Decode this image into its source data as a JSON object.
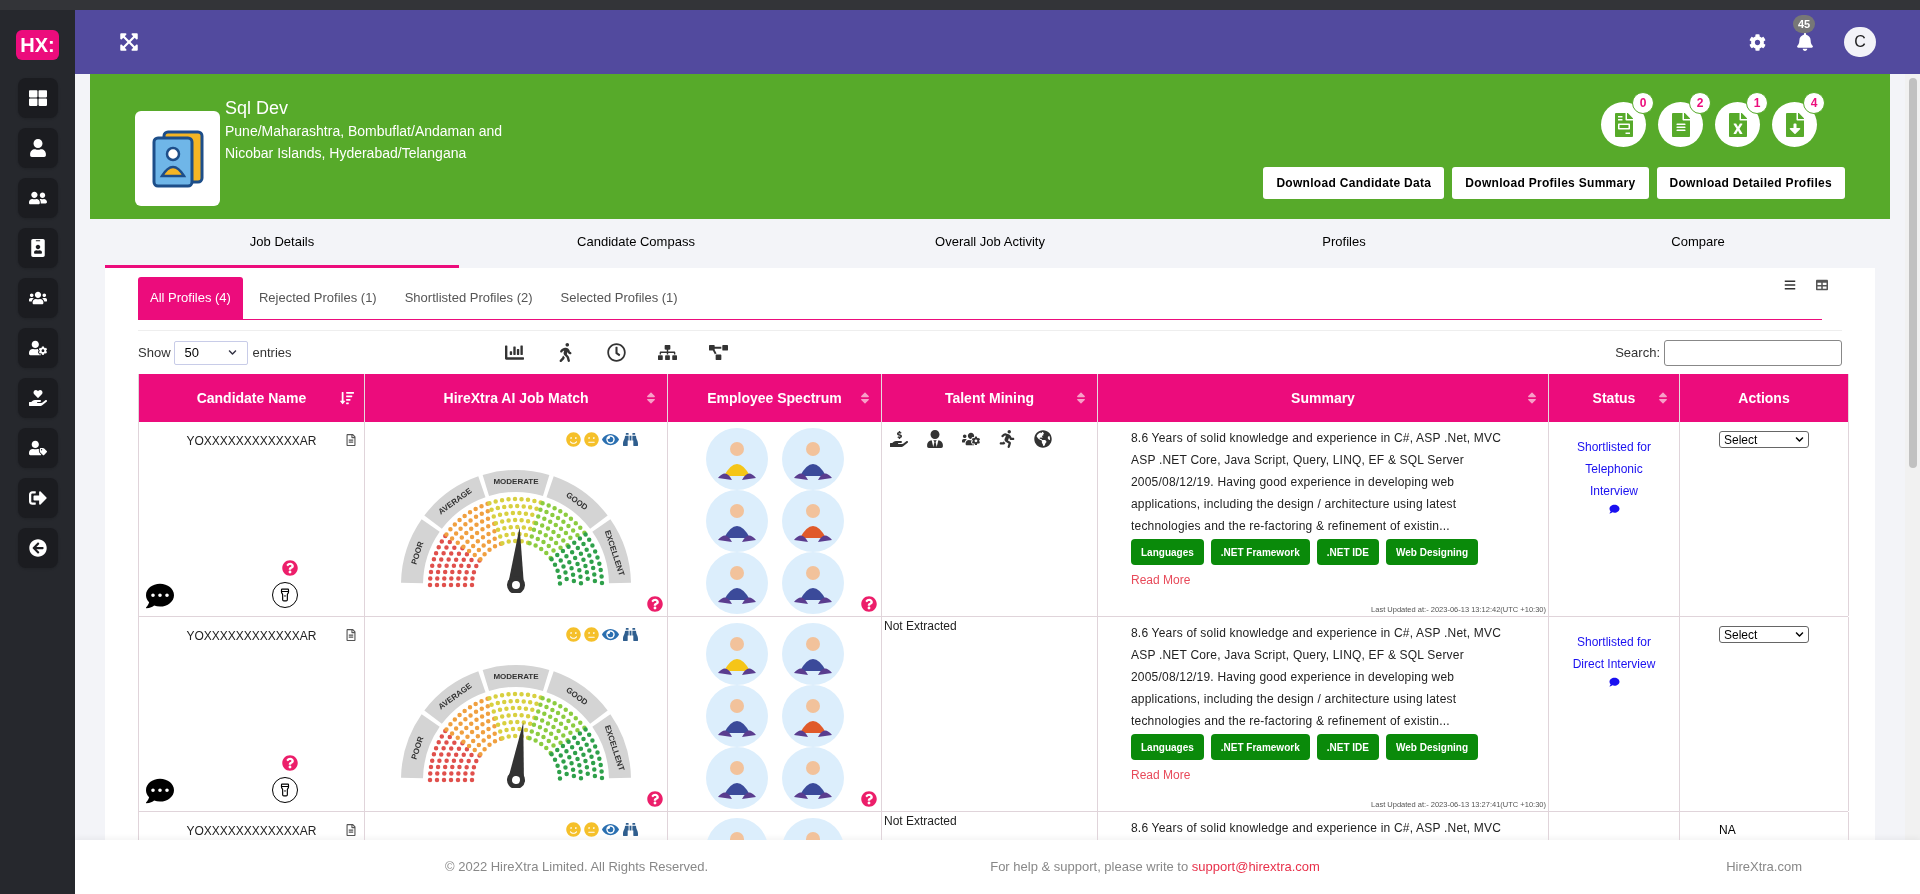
{
  "logo": "HX:",
  "header": {
    "notification_count": "45",
    "avatar_initial": "C"
  },
  "job": {
    "title": "Sql Dev",
    "locations": "Pune/Maharashtra, Bombuflat/Andaman and Nicobar Islands, Hyderabad/Telangana"
  },
  "counters": [
    {
      "count": "0"
    },
    {
      "count": "2"
    },
    {
      "count": "1"
    },
    {
      "count": "4"
    }
  ],
  "download_buttons": [
    "Download Candidate Data",
    "Download Profiles Summary",
    "Download Detailed Profiles"
  ],
  "main_tabs": [
    {
      "label": "Job Details",
      "selected": true
    },
    {
      "label": "Candidate Compass",
      "selected": false
    },
    {
      "label": "Overall Job Activity",
      "selected": false
    },
    {
      "label": "Profiles",
      "selected": false
    },
    {
      "label": "Compare",
      "selected": false
    }
  ],
  "profile_tabs": [
    {
      "label": "All Profiles (4)",
      "selected": true
    },
    {
      "label": "Rejected Profiles (1)",
      "selected": false
    },
    {
      "label": "Shortlisted Profiles (2)",
      "selected": false
    },
    {
      "label": "Selected Profiles (1)",
      "selected": false
    }
  ],
  "table_controls": {
    "show_label": "Show",
    "page_size": "50",
    "entries_label": "entries",
    "search_label": "Search:"
  },
  "columns": [
    {
      "label": "Candidate Name",
      "sortable": true,
      "sorted": true
    },
    {
      "label": "HireXtra AI Job Match",
      "sortable": true,
      "sorted": false
    },
    {
      "label": "Employee Spectrum",
      "sortable": true,
      "sorted": false
    },
    {
      "label": "Talent Mining",
      "sortable": true,
      "sorted": false
    },
    {
      "label": "Summary",
      "sortable": true,
      "sorted": false
    },
    {
      "label": "Status",
      "sortable": true,
      "sorted": false
    },
    {
      "label": "Actions",
      "sortable": false
    }
  ],
  "rows": [
    {
      "candidate": "YOXXXXXXXXXXXXAR",
      "gauge": {
        "level": 0.52,
        "labels": [
          "POOR",
          "AVERAGE",
          "MODERATE",
          "GOOD",
          "EXCELLENT"
        ]
      },
      "talent": {
        "kind": "icons"
      },
      "summary": "8.6 Years of solid knowledge and experience in C#, ASP .Net, MVC ASP .NET Core, Java Script, Query, LINQ, EF & SQL Server 2005/08/12/19. Having good experience in developing web applications, including the design / architecture using latest technologies and the re-factoring & refinement of existin...",
      "skills": [
        "Languages",
        ".NET Framework",
        ".NET IDE",
        "Web Designing"
      ],
      "read_more": "Read More",
      "updated": "Last Updated at:- 2023-06-13 13:12:42(UTC +10:30)",
      "status": "Shortlisted for Telephonic Interview",
      "action": {
        "kind": "select",
        "value": "Select"
      }
    },
    {
      "candidate": "YOXXXXXXXXXXXXAR",
      "gauge": {
        "level": 0.54,
        "labels": [
          "POOR",
          "AVERAGE",
          "MODERATE",
          "GOOD",
          "EXCELLENT"
        ]
      },
      "talent": {
        "kind": "text",
        "text": "Not Extracted"
      },
      "summary": "8.6 Years of solid knowledge and experience in C#, ASP .Net, MVC ASP .NET Core, Java Script, Query, LINQ, EF & SQL Server 2005/08/12/19. Having good experience in developing web applications, including the design / architecture using latest technologies and the re-factoring & refinement of existin...",
      "skills": [
        "Languages",
        ".NET Framework",
        ".NET IDE",
        "Web Designing"
      ],
      "read_more": "Read More",
      "updated": "Last Updated at:- 2023-06-13 13:27:41(UTC +10:30)",
      "status": "Shortlisted for Direct Interview",
      "action": {
        "kind": "select",
        "value": "Select"
      }
    },
    {
      "candidate": "YOXXXXXXXXXXXXAR",
      "talent": {
        "kind": "text",
        "text": "Not Extracted"
      },
      "summary": "8.6 Years of solid knowledge and experience in C#, ASP .Net, MVC",
      "action": {
        "kind": "text",
        "text": "NA"
      }
    }
  ],
  "footer": {
    "copyright": "© 2022 HireXtra Limited. All Rights Reserved.",
    "help": "For help & support, please write to",
    "email": "support@hirextra.com",
    "site": "HireXtra.com"
  }
}
